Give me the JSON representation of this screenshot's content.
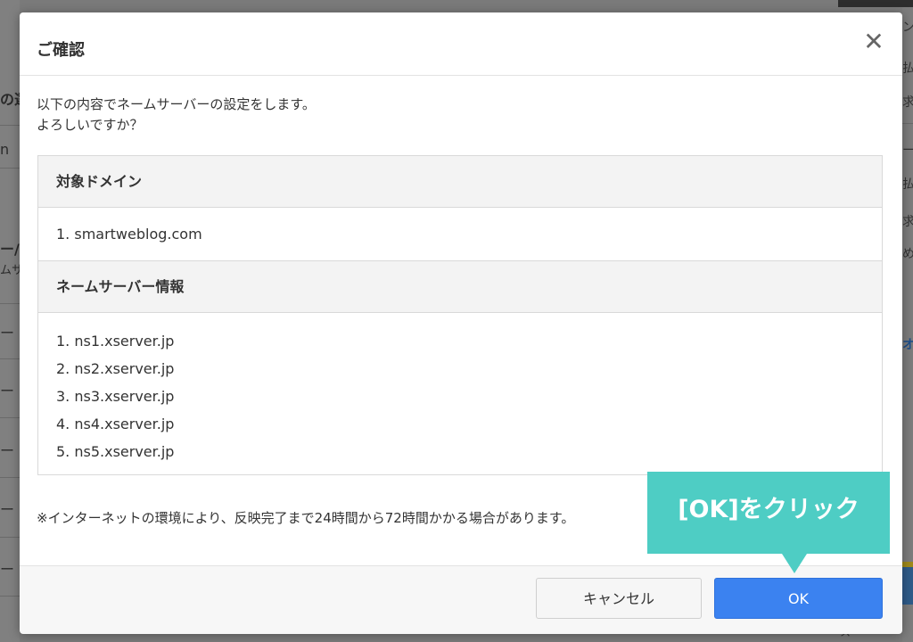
{
  "background": {
    "left_texts": [
      "の選",
      "n",
      "ー/",
      "ムサ",
      "ー",
      "ー",
      "ー",
      "ー",
      "ー"
    ],
    "right_texts": [
      "ン",
      "払",
      "求",
      "ー",
      "払",
      "求",
      "め",
      "オ",
      "ス"
    ]
  },
  "dialog": {
    "title": "ご確認",
    "close_icon": "close-icon",
    "message_lines": [
      "以下の内容でネームサーバーの設定をします。",
      "よろしいですか？"
    ],
    "sections": {
      "domain_header": "対象ドメイン",
      "domain_items": [
        "1. smartweblog.com"
      ],
      "ns_header": "ネームサーバー情報",
      "ns_items": [
        "1. ns1.xserver.jp",
        "2. ns2.xserver.jp",
        "3. ns3.xserver.jp",
        "4. ns4.xserver.jp",
        "5. ns5.xserver.jp"
      ]
    },
    "note": "※インターネットの環境により、反映完了まで24時間から72時間かかる場合があります。",
    "buttons": {
      "cancel_label": "キャンセル",
      "ok_label": "OK"
    }
  },
  "annotation": {
    "text": "[OK]をクリック",
    "color": "#4ecdc4"
  },
  "colors": {
    "primary_button": "#3b82f0",
    "overlay": "#7a7a7a"
  }
}
